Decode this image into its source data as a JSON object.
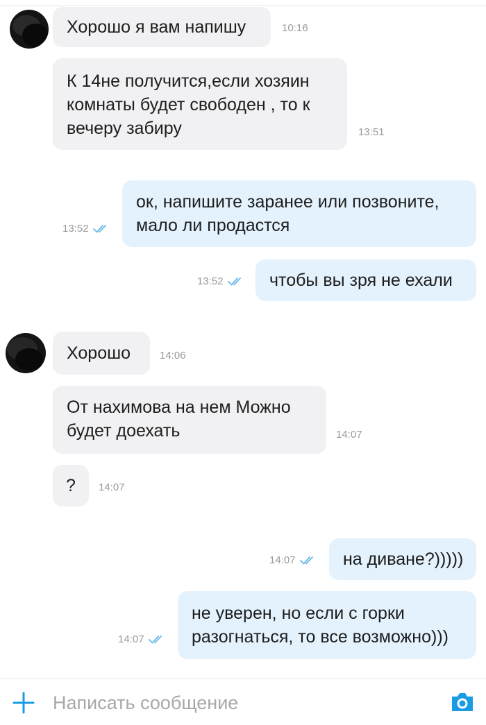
{
  "colors": {
    "incoming_bubble": "#f1f1f3",
    "outgoing_bubble": "#e3f2fc",
    "accent": "#1a9be6",
    "timestamp": "#9a9a9a",
    "read_check": "#68b8ec"
  },
  "icons": {
    "read_status": "double-check-icon",
    "attach": "plus-icon",
    "camera": "camera-icon"
  },
  "messages": [
    {
      "direction": "incoming",
      "text": "Хорошо я вам напишу",
      "time": "10:16"
    },
    {
      "direction": "incoming",
      "text": "К 14не получится,если хозяин\nкомнаты будет свободен , то к\nвечеру забиру",
      "time": "13:51"
    },
    {
      "direction": "outgoing",
      "text": "ок, напишите заранее или позвоните,\nмало ли продастся",
      "time": "13:52",
      "read": true
    },
    {
      "direction": "outgoing",
      "text": "чтобы вы зря не ехали",
      "time": "13:52",
      "read": true
    },
    {
      "direction": "incoming",
      "text": "Хорошо",
      "time": "14:06"
    },
    {
      "direction": "incoming",
      "text": "От нахимова на нем Можно\nбудет доехать",
      "time": "14:07"
    },
    {
      "direction": "incoming",
      "text": "?",
      "time": "14:07"
    },
    {
      "direction": "outgoing",
      "text": "на диване?)))))",
      "time": "14:07",
      "read": true
    },
    {
      "direction": "outgoing",
      "text": "не уверен, но если с горки\nразогнаться, то все возможно)))",
      "time": "14:07",
      "read": true
    }
  ],
  "composer": {
    "placeholder": "Написать сообщение",
    "value": ""
  }
}
